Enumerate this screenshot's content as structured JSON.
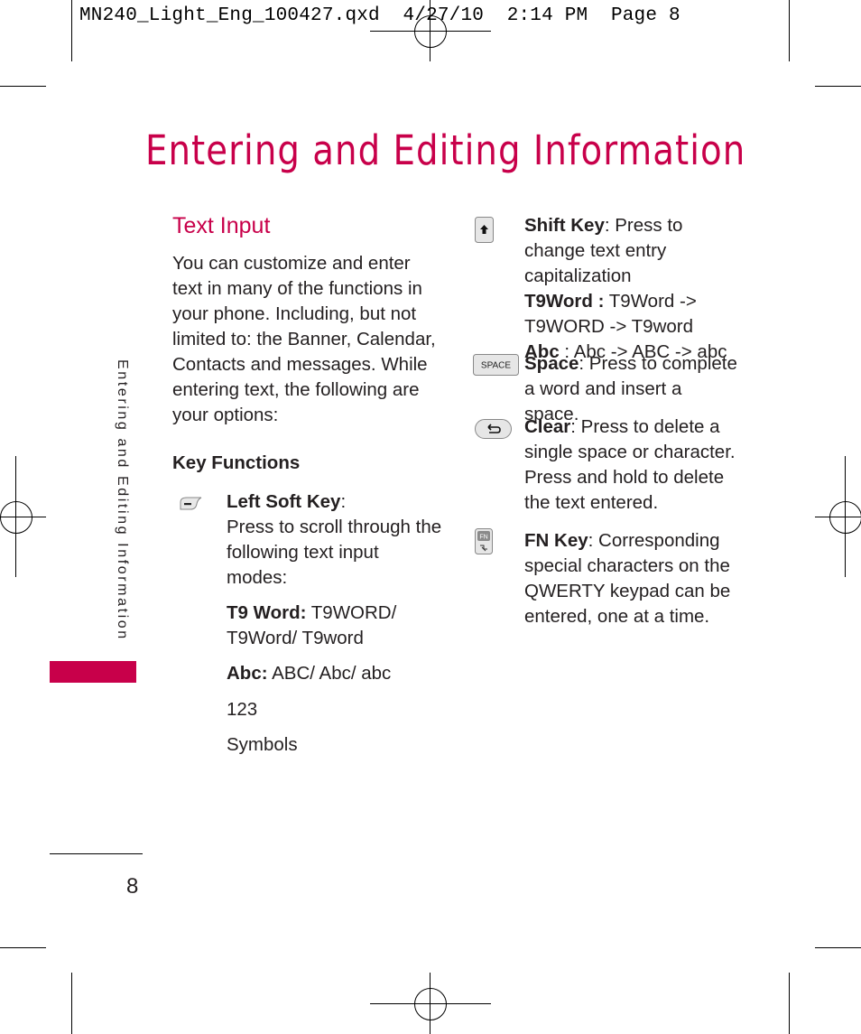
{
  "slug": {
    "filename": "MN240_Light_Eng_100427.qxd",
    "date": "4/27/10",
    "time": "2:14 PM",
    "page_label": "Page 8"
  },
  "page": {
    "title": "Entering and Editing Information",
    "side_tab": "Entering and Editing Information",
    "page_number": "8",
    "accent_color": "#c8004a"
  },
  "text_input": {
    "heading": "Text Input",
    "intro": "You can customize and enter text in many of the functions in your phone. Including, but not limited to: the Banner, Calendar, Contacts and messages. While entering text, the following are your options:"
  },
  "key_functions": {
    "heading": "Key Functions",
    "left_soft_key": {
      "icon": "left-soft-key-icon",
      "label": "Left Soft Key",
      "sep": ":",
      "description": "Press to scroll through the following text input modes:",
      "modes": [
        {
          "label": "T9 Word:",
          "value": " T9WORD/ T9Word/ T9word"
        },
        {
          "label": "Abc:",
          "value": " ABC/ Abc/ abc"
        },
        {
          "label": "123",
          "value": ""
        },
        {
          "label": "Symbols",
          "value": ""
        }
      ]
    },
    "shift_key": {
      "icon": "shift-key-icon",
      "label": "Shift Key",
      "description": ": Press to change text entry capitalization",
      "t9_label": "T9Word :",
      "t9_value": " T9Word -> T9WORD -> T9word",
      "abc_label": "Abc",
      "abc_value": " : Abc -> ABC -> abc"
    },
    "space_key": {
      "icon": "space-key-icon",
      "icon_text": "SPACE",
      "label": "Space",
      "description": ": Press to complete a word and insert a space."
    },
    "clear_key": {
      "icon": "clear-key-icon",
      "label": "Clear",
      "description": ": Press to delete a single space or character. Press and hold to delete the text entered."
    },
    "fn_key": {
      "icon": "fn-key-icon",
      "icon_text": "FN",
      "label": "FN Key",
      "description": ": Corresponding special characters on the QWERTY keypad can be entered, one at a time."
    }
  }
}
